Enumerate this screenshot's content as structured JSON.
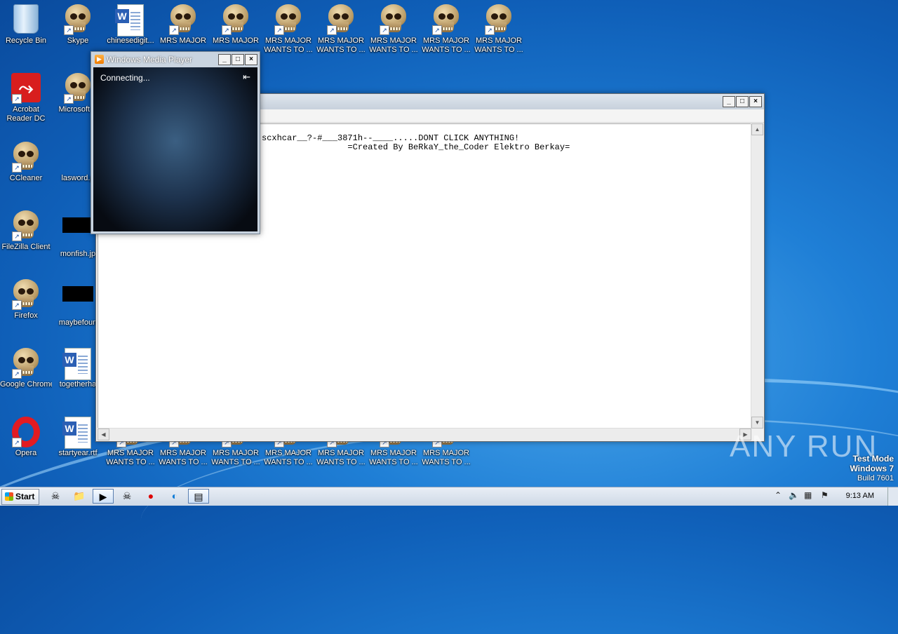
{
  "desktop": {
    "icons": [
      {
        "label": "Recycle Bin",
        "type": "recycle"
      },
      {
        "label": "Skype",
        "type": "skull"
      },
      {
        "label": "chinesedigit...",
        "type": "word"
      },
      {
        "label": "MRS MAJOR",
        "type": "skull"
      },
      {
        "label": "MRS MAJOR",
        "type": "skull"
      },
      {
        "label": "MRS MAJOR WANTS TO ...",
        "type": "skull"
      },
      {
        "label": "MRS MAJOR WANTS TO ...",
        "type": "skull"
      },
      {
        "label": "MRS MAJOR WANTS TO ...",
        "type": "skull"
      },
      {
        "label": "MRS MAJOR WANTS TO ...",
        "type": "skull"
      },
      {
        "label": "MRS MAJOR WANTS TO ...",
        "type": "skull"
      },
      {
        "label": "Acrobat Reader DC",
        "type": "acrobat"
      },
      {
        "label": "Microsoft E",
        "type": "skull"
      },
      {
        "label": "CCleaner",
        "type": "skull"
      },
      {
        "label": "lasword.p",
        "type": "blank"
      },
      {
        "label": "FileZilla Client",
        "type": "skull"
      },
      {
        "label": "monfish.jp",
        "type": "black"
      },
      {
        "label": "Firefox",
        "type": "skull"
      },
      {
        "label": "maybefoun",
        "type": "black"
      },
      {
        "label": "Google Chrome",
        "type": "skull"
      },
      {
        "label": "togetherha",
        "type": "word"
      },
      {
        "label": "Opera",
        "type": "opera"
      },
      {
        "label": "startyear.rtf",
        "type": "word"
      },
      {
        "label": "MRS MAJOR WANTS TO ...",
        "type": "skull"
      },
      {
        "label": "MRS MAJOR WANTS TO ...",
        "type": "skull"
      },
      {
        "label": "MRS MAJOR WANTS TO ...",
        "type": "skull"
      },
      {
        "label": "MRS MAJOR WANTS TO ...",
        "type": "skull"
      },
      {
        "label": "MRS MAJOR WANTS TO ...",
        "type": "skull"
      },
      {
        "label": "MRS MAJOR WANTS TO ...",
        "type": "skull"
      },
      {
        "label": "MRS MAJOR WANTS TO ...",
        "type": "skull"
      }
    ]
  },
  "notepad": {
    "line1": "scxhcar__?-#___3871h--____.....DONT CLICK ANYTHING!",
    "line2": "                 =Created By BeRkaY_the_Coder Elektro Berkay="
  },
  "wmp": {
    "title": "Windows Media Player",
    "status": "Connecting..."
  },
  "taskbar": {
    "start_label": "Start",
    "clock": "9:13 AM"
  },
  "watermark": {
    "brand": "ANY RUN",
    "mode": "Test Mode",
    "os": "Windows 7",
    "build": "Build 7601"
  },
  "caption_buttons": {
    "min": "_",
    "max": "□",
    "close": "×"
  }
}
